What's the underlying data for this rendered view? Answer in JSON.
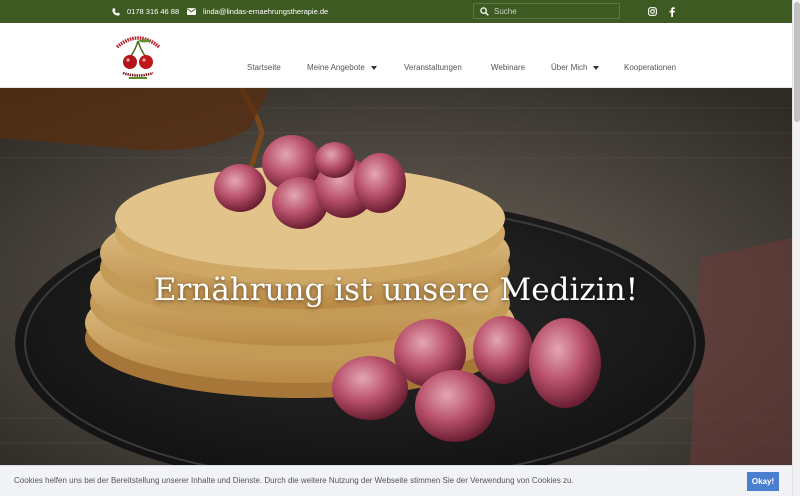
{
  "topbar": {
    "phone": "0178 316 46 88",
    "email": "linda@lindas-ernaehrungstherapie.de",
    "search_placeholder": "Suche",
    "icons": [
      "phone-icon",
      "envelope-icon",
      "search-icon",
      "instagram-icon",
      "facebook-icon"
    ]
  },
  "nav": {
    "items": [
      {
        "label": "Startseite"
      },
      {
        "label": "Meine Angebote"
      },
      {
        "label": "Veranstaltungen"
      },
      {
        "label": "Webinare"
      },
      {
        "label": "Über Mich"
      },
      {
        "label": "Kooperationen"
      }
    ]
  },
  "hero": {
    "title": "Ernährung ist unsere Medizin!"
  },
  "cookie": {
    "text": "Cookies helfen uns bei der Bereitstellung unserer Inhalte und Dienste. Durch die weitere Nutzung der Webseite stimmen Sie der Verwendung von Cookies zu.",
    "button": "Okay!"
  },
  "colors": {
    "topbar": "#3d5a23",
    "cookie_button": "#4a7fd0",
    "nav_text": "#555555"
  }
}
